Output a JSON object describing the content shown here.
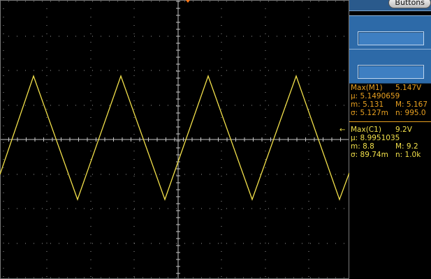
{
  "panel": {
    "buttons_label": "Buttons"
  },
  "measurement_1": {
    "label": "Max(M1)",
    "value": "5.147V",
    "mean": "μ: 5.1490659",
    "min": "m: 5.131",
    "max": "M: 5.167",
    "sigma": "σ: 5.127m",
    "count": "n:  995.0"
  },
  "measurement_2": {
    "label": "Max(C1)",
    "value": "9.2V",
    "mean": "μ: 8.9951035",
    "min": "m: 8.8",
    "max": "M: 9.2",
    "sigma": "σ: 89.74m",
    "count": "n:  1.0k"
  },
  "channel_marker": "←",
  "waveform": {
    "type": "triangle",
    "color": "#f2e04a",
    "points": [
      [
        0,
        250
      ],
      [
        48,
        109
      ],
      [
        111,
        286
      ],
      [
        173,
        109
      ],
      [
        236,
        286
      ],
      [
        298,
        109
      ],
      [
        361,
        286
      ],
      [
        424,
        109
      ],
      [
        486,
        286
      ],
      [
        500,
        248
      ]
    ]
  },
  "colors": {
    "measurement_1": "#e8a020",
    "measurement_2": "#f2e04a",
    "trigger_marker": "#ff7a1a",
    "grid": "#9a9a9a"
  }
}
